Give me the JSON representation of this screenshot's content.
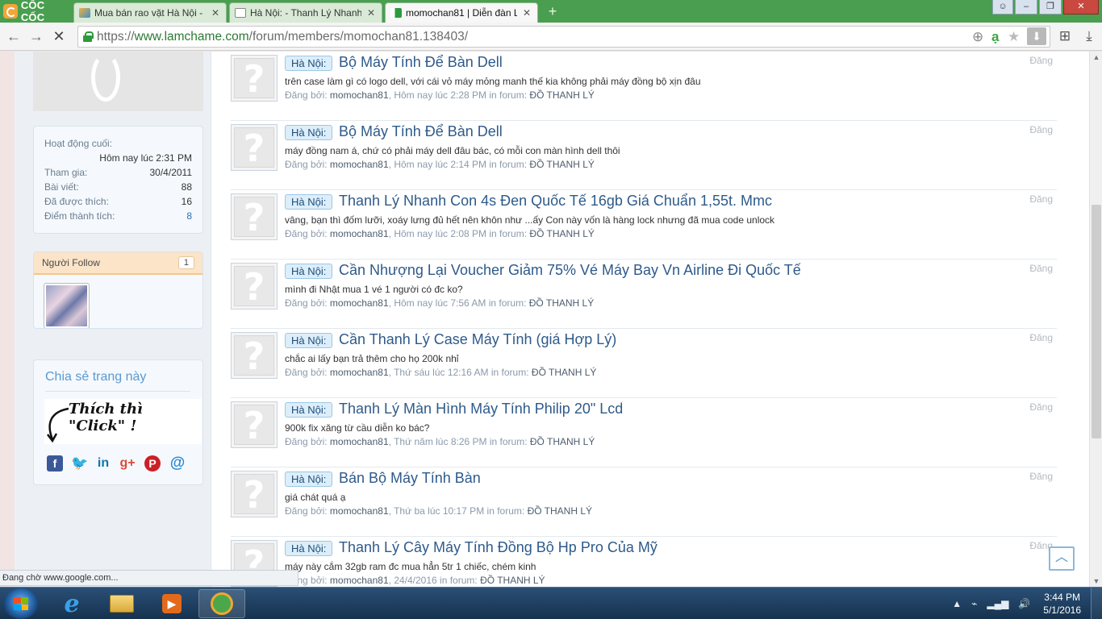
{
  "browser": {
    "brand": "CỐC CỐC",
    "tabs": [
      {
        "label": "Mua bán rao vặt Hà Nội - "
      },
      {
        "label": "Hà Nội: - Thanh Lý Nhanh"
      },
      {
        "label": "momochan81 | Diễn đàn L"
      }
    ],
    "url": {
      "scheme": "https://",
      "host": "www.lamchame.com",
      "path": "/forum/members/momochan81.138403/"
    },
    "colors": {
      "chrome": "#4a9e4f",
      "link": "#2e5a8a",
      "accent": "#f2c58d"
    }
  },
  "sidebar": {
    "last_active_label": "Hoạt động cuối:",
    "last_active_value": "Hôm nay lúc 2:31 PM",
    "stats": [
      {
        "label": "Tham gia:",
        "value": "30/4/2011"
      },
      {
        "label": "Bài viết:",
        "value": "88"
      },
      {
        "label": "Đã được thích:",
        "value": "16"
      },
      {
        "label": "Điểm thành tích:",
        "value": "8"
      }
    ],
    "follow_label": "Người Follow",
    "follow_count": "1",
    "share_title": "Chia sẻ trang này",
    "click_banner": "Thích thì \"Click\" !"
  },
  "feed": {
    "prefix": "Hà Nội:",
    "author": "momochan81",
    "by_label": "Đăng bởi:",
    "forum_label": "in forum:",
    "forum": "ĐỒ THANH LÝ",
    "side_label": "Đăng",
    "items": [
      {
        "title": "Bộ Máy Tính Để Bàn Dell",
        "snippet": "trên case làm gì có logo dell, với cái vỏ máy mỏng manh thế kia không phải máy đồng bộ xịn đâu",
        "time": "Hôm nay lúc 2:28 PM"
      },
      {
        "title": "Bộ Máy Tính Để Bàn Dell",
        "snippet": "máy đồng nam á, chứ có phải máy dell đâu bác, có mỗi con màn hình dell thôi",
        "time": "Hôm nay lúc 2:14 PM"
      },
      {
        "title": "Thanh Lý Nhanh Con 4s Đen Quốc Tế 16gb Giá Chuẩn 1,55t. Mmc",
        "snippet": "vâng, bạn thì đốm lưỡi, xoáy lưng đủ hết nên khôn như ...ấy Con này vốn là hàng lock nhưng đã mua code unlock",
        "time": "Hôm nay lúc 2:08 PM"
      },
      {
        "title": "Cần Nhượng Lại Voucher Giảm 75% Vé Máy Bay Vn Airline Đi Quốc Tế",
        "snippet": "mình đi Nhật mua 1 vé 1 người có đc ko?",
        "time": "Hôm nay lúc 7:56 AM"
      },
      {
        "title": "Cần Thanh Lý Case Máy Tính (giá Hợp Lý)",
        "snippet": "chắc ai lấy bạn trả thêm cho họ 200k nhỉ",
        "time": "Thứ sáu lúc 12:16 AM"
      },
      {
        "title": "Thanh Lý Màn Hình Máy Tính Philip 20\" Lcd",
        "snippet": "900k fix xăng từ cầu diễn ko bác?",
        "time": "Thứ năm lúc 8:26 PM"
      },
      {
        "title": "Bán Bộ Máy Tính Bàn",
        "snippet": "giá chát quá ạ",
        "time": "Thứ ba lúc 10:17 PM"
      },
      {
        "title": "Thanh Lý Cây Máy Tính Đồng Bộ Hp Pro Của Mỹ",
        "snippet": "máy này cắm 32gb ram đc mua hẳn 5tr 1 chiếc, chém kinh",
        "time": "24/4/2016"
      }
    ]
  },
  "status_text": "Đang chờ www.google.com...",
  "taskbar": {
    "time": "3:44 PM",
    "date": "5/1/2016"
  }
}
